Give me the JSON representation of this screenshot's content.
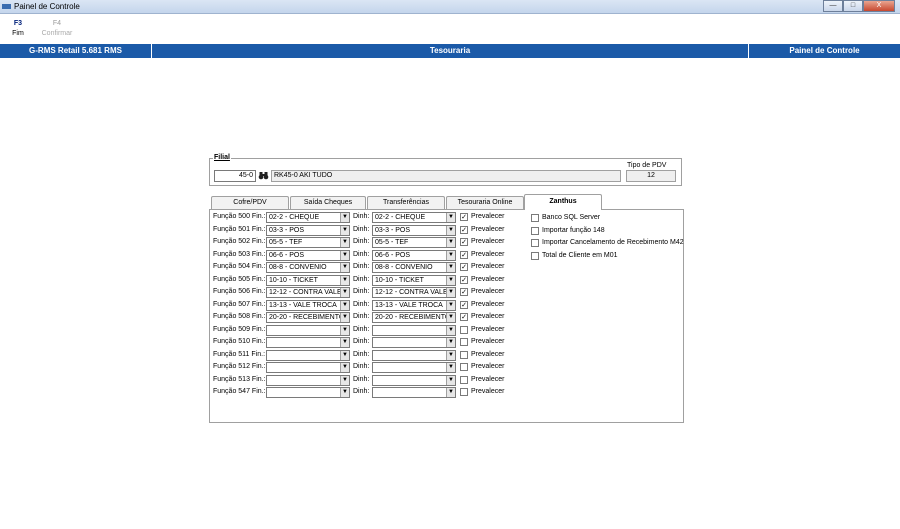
{
  "window": {
    "title": "Painel de Controle",
    "minimize": "—",
    "maximize": "□",
    "close": "X"
  },
  "toolbar": {
    "f3_key": "F3",
    "f3_label": "Fim",
    "f4_key": "F4",
    "f4_label": "Confirmar"
  },
  "header": {
    "left": "G-RMS Retail 5.681 RMS",
    "center": "Tesouraria",
    "right": "Painel de Controle"
  },
  "filial": {
    "label": "Filial",
    "code": "45-0",
    "name": "RK45-0 AKI TUDO",
    "tipo_pdv_label": "Tipo de PDV",
    "tipo_pdv": "12"
  },
  "tabs": [
    "Cofre/PDV",
    "Saída Cheques",
    "Transferências",
    "Tesouraria Online",
    "Zanthus"
  ],
  "active_tab": "Zanthus",
  "rows": [
    {
      "label": "Função 500 Fin.:",
      "fin": "02-2 - CHEQUE",
      "dinh_label": "Dinh:",
      "dinh": "02-2 - CHEQUE",
      "prevalecer": true,
      "prev_label": "Prevalecer"
    },
    {
      "label": "Função 501 Fin.:",
      "fin": "03-3 - POS",
      "dinh_label": "Dinh:",
      "dinh": "03-3 - POS",
      "prevalecer": true,
      "prev_label": "Prevalecer"
    },
    {
      "label": "Função 502 Fin.:",
      "fin": "05-5 - TEF",
      "dinh_label": "Dinh:",
      "dinh": "05-5 - TEF",
      "prevalecer": true,
      "prev_label": "Prevalecer"
    },
    {
      "label": "Função 503 Fin.:",
      "fin": "06-6 - POS",
      "dinh_label": "Dinh:",
      "dinh": "06-6 - POS",
      "prevalecer": true,
      "prev_label": "Prevalecer"
    },
    {
      "label": "Função 504 Fin.:",
      "fin": "08-8 - CONVENIO",
      "dinh_label": "Dinh:",
      "dinh": "08-8 - CONVENIO",
      "prevalecer": true,
      "prev_label": "Prevalecer"
    },
    {
      "label": "Função 505 Fin.:",
      "fin": "10-10 - TICKET",
      "dinh_label": "Dinh:",
      "dinh": "10-10 - TICKET",
      "prevalecer": true,
      "prev_label": "Prevalecer"
    },
    {
      "label": "Função 506 Fin.:",
      "fin": "12-12 - CONTRA VALE",
      "dinh_label": "Dinh:",
      "dinh": "12-12 - CONTRA VALE",
      "prevalecer": true,
      "prev_label": "Prevalecer"
    },
    {
      "label": "Função 507 Fin.:",
      "fin": "13-13 - VALE TROCA",
      "dinh_label": "Dinh:",
      "dinh": "13-13 - VALE TROCA",
      "prevalecer": true,
      "prev_label": "Prevalecer"
    },
    {
      "label": "Função 508 Fin.:",
      "fin": "20-20 - RECEBIMENTO",
      "dinh_label": "Dinh:",
      "dinh": "20-20 - RECEBIMENTO",
      "prevalecer": true,
      "prev_label": "Prevalecer"
    },
    {
      "label": "Função 509 Fin.:",
      "fin": "",
      "dinh_label": "Dinh:",
      "dinh": "",
      "prevalecer": false,
      "prev_label": "Prevalecer"
    },
    {
      "label": "Função 510 Fin.:",
      "fin": "",
      "dinh_label": "Dinh:",
      "dinh": "",
      "prevalecer": false,
      "prev_label": "Prevalecer"
    },
    {
      "label": "Função 511 Fin.:",
      "fin": "",
      "dinh_label": "Dinh:",
      "dinh": "",
      "prevalecer": false,
      "prev_label": "Prevalecer"
    },
    {
      "label": "Função 512 Fin.:",
      "fin": "",
      "dinh_label": "Dinh:",
      "dinh": "",
      "prevalecer": false,
      "prev_label": "Prevalecer"
    },
    {
      "label": "Função 513 Fin.:",
      "fin": "",
      "dinh_label": "Dinh:",
      "dinh": "",
      "prevalecer": false,
      "prev_label": "Prevalecer"
    },
    {
      "label": "Função 547 Fin.:",
      "fin": "",
      "dinh_label": "Dinh:",
      "dinh": "",
      "prevalecer": false,
      "prev_label": "Prevalecer"
    }
  ],
  "options": [
    {
      "label": "Banco SQL Server",
      "checked": false
    },
    {
      "label": "Importar função 148",
      "checked": false
    },
    {
      "label": "Importar Cancelamento de Recebimento M42",
      "checked": false
    },
    {
      "label": "Total de Cliente em M01",
      "checked": false
    }
  ],
  "icons": {
    "app": "app-icon",
    "binoculars": "binoculars-icon",
    "dropdown": "chevron-down-icon"
  }
}
